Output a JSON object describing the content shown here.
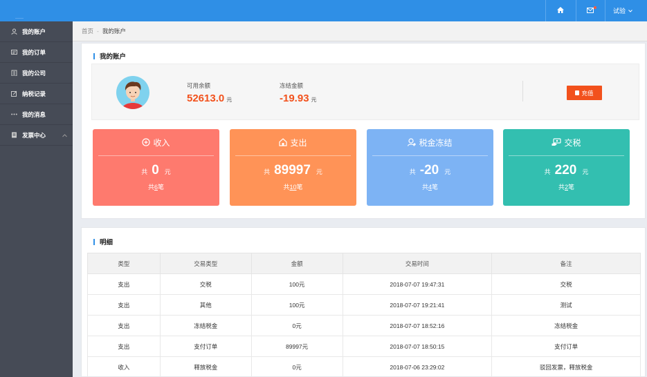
{
  "topbar": {
    "home_icon": "home-icon",
    "mail_icon": "mail-icon",
    "user_label": "试验",
    "accent": "#2f8fe6"
  },
  "sidebar": {
    "items": [
      {
        "label": "我的账户",
        "icon": "user-icon"
      },
      {
        "label": "我的订单",
        "icon": "order-icon"
      },
      {
        "label": "我的公司",
        "icon": "company-icon"
      },
      {
        "label": "纳税记录",
        "icon": "edit-icon"
      },
      {
        "label": "我的消息",
        "icon": "more-icon"
      },
      {
        "label": "发票中心",
        "icon": "invoice-icon"
      }
    ]
  },
  "breadcrumb": {
    "home": "首页",
    "sep": "-",
    "current": "我的账户"
  },
  "account": {
    "title": "我的账户",
    "available_label": "可用余额",
    "available_value": "52613.0",
    "frozen_label": "冻结金额",
    "frozen_value": "-19.93",
    "unit": "元",
    "recharge_label": "充值"
  },
  "cards": [
    {
      "title": "收入",
      "prefix": "共",
      "amount": "0",
      "unit": "元",
      "count_prefix": "共",
      "count": "6",
      "count_suffix": "笔",
      "color": "#fe7a6e"
    },
    {
      "title": "支出",
      "prefix": "共",
      "amount": "89997",
      "unit": "元",
      "count_prefix": "共",
      "count": "10",
      "count_suffix": "笔",
      "color": "#ff9357"
    },
    {
      "title": "税金冻结",
      "prefix": "共",
      "amount": "-20",
      "unit": "元",
      "count_prefix": "共",
      "count": "4",
      "count_suffix": "笔",
      "color": "#7db3f4"
    },
    {
      "title": "交税",
      "prefix": "共",
      "amount": "220",
      "unit": "元",
      "count_prefix": "共",
      "count": "2",
      "count_suffix": "笔",
      "color": "#33bfb0"
    }
  ],
  "detail": {
    "title": "明细",
    "headers": [
      "类型",
      "交易类型",
      "金额",
      "交易时间",
      "备注"
    ],
    "rows": [
      [
        "支出",
        "交税",
        "100元",
        "2018-07-07 19:47:31",
        "交税"
      ],
      [
        "支出",
        "其他",
        "100元",
        "2018-07-07 19:21:41",
        "测试"
      ],
      [
        "支出",
        "冻结税金",
        "0元",
        "2018-07-07 18:52:16",
        "冻结税金"
      ],
      [
        "支出",
        "支付订单",
        "89997元",
        "2018-07-07 18:50:15",
        "支付订单"
      ],
      [
        "收入",
        "释放税金",
        "0元",
        "2018-07-06 23:29:02",
        "驳回发票，释放税金"
      ]
    ]
  }
}
